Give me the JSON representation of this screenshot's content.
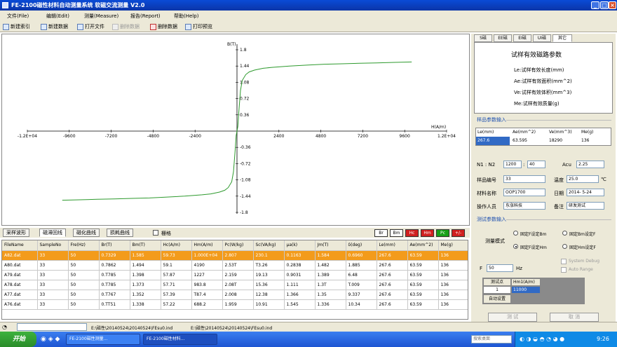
{
  "window": {
    "title": "FE-2100磁性材料自动测量系统 软磁交流测量 V2.0"
  },
  "menu": [
    {
      "label": "文件(File)"
    },
    {
      "label": "编辑(Edit)"
    },
    {
      "label": "测量(Measure)"
    },
    {
      "label": "报告(Report)"
    },
    {
      "label": "帮助(Help)"
    }
  ],
  "toolbar": [
    {
      "label": "新建索引",
      "disabled": false
    },
    {
      "label": "新建数据",
      "disabled": false
    },
    {
      "label": "打开文件",
      "disabled": false
    },
    {
      "label": "删除数据",
      "disabled": true
    },
    {
      "label": "删除数据",
      "disabled": false
    },
    {
      "label": "打印预览",
      "disabled": false
    }
  ],
  "chart_data": {
    "type": "line",
    "title": "",
    "xlabel": "H(A/m)",
    "ylabel": "B(T)",
    "xlim": [
      -12000,
      12000
    ],
    "ylim": [
      -1.8,
      1.8
    ],
    "x_ticks": [
      "-1.2E+04",
      "-9600",
      "-7200",
      "-4800",
      "-2400",
      "2400",
      "4800",
      "7200",
      "9600",
      "1.2E+04"
    ],
    "y_ticks": [
      "1.8",
      "1.44",
      "1.08",
      "0.72",
      "0.36",
      "-0.36",
      "-0.72",
      "-1.08",
      "-1.44",
      "-1.8"
    ],
    "grid": false,
    "series": [
      {
        "color": "#2e9a2e",
        "x": [
          -10000,
          -9000,
          -8000,
          -7000,
          -6000,
          -5000,
          -4000,
          -3000,
          -2000,
          -1500,
          -1000,
          -700,
          -500,
          -300,
          -200,
          -100,
          -50,
          0,
          50,
          100,
          200,
          300,
          500,
          700,
          1000,
          1500,
          2000,
          3000,
          4000,
          5000,
          6000,
          7000,
          8000,
          9000,
          10000
        ],
        "y": [
          -1.53,
          -1.52,
          -1.51,
          -1.5,
          -1.49,
          -1.48,
          -1.46,
          -1.44,
          -1.41,
          -1.39,
          -1.35,
          -1.31,
          -1.25,
          -1.12,
          -0.9,
          -0.4,
          -0.1,
          0.0,
          0.1,
          0.4,
          0.9,
          1.12,
          1.25,
          1.31,
          1.35,
          1.39,
          1.41,
          1.44,
          1.46,
          1.48,
          1.49,
          1.5,
          1.51,
          1.52,
          1.53
        ]
      }
    ]
  },
  "bottom_tabs": [
    {
      "label": "采样波形",
      "active": false
    },
    {
      "label": "磁滞回线",
      "active": true
    },
    {
      "label": "磁化曲线",
      "active": false
    },
    {
      "label": "损耗曲线",
      "active": false
    }
  ],
  "grid_check_label": "栅格",
  "indicators": [
    {
      "label": "Br",
      "color": "#ffffff",
      "text_color": "#000000"
    },
    {
      "label": "Bm",
      "color": "#ffffff",
      "text_color": "#000000"
    },
    {
      "label": "Hc",
      "color": "#d02020",
      "text_color": "#ffffff"
    },
    {
      "label": "Hm",
      "color": "#d02020",
      "text_color": "#ffffff"
    },
    {
      "label": "Pc",
      "color": "#18a018",
      "text_color": "#ffffff"
    },
    {
      "label": "+/-",
      "color": "#d02020",
      "text_color": "#ffffff"
    }
  ],
  "table": {
    "columns": [
      "FileName",
      "SampleNo",
      "Fre(Hz)",
      "Br(T)",
      "Bm(T)",
      "Hc(A/m)",
      "Hm(A/m)",
      "Pc(W/kg)",
      "Sc(VA/kg)",
      "μa(k)",
      "Jm(T)",
      "δ(deg)",
      "Le(mm)",
      "Ae(mm^2)",
      "Me(g)"
    ],
    "rows": [
      [
        "A82.dat",
        "33",
        "50",
        "0.7329",
        "1.585",
        "59.73",
        "1.000E+04",
        "2.807",
        "230.1",
        "0.1163",
        "1.584",
        "0.6960",
        "267.6",
        "63.59",
        "136"
      ],
      [
        "A80.dat",
        "33",
        "50",
        "0.7862",
        "1.494",
        "59.1",
        "4190",
        "2.53T",
        "T3.26",
        "0.2838",
        "1.482",
        "1.885",
        "267.6",
        "63.59",
        "136"
      ],
      [
        "A79.dat",
        "33",
        "50",
        "0.T785",
        "1.398",
        "57.87",
        "1227",
        "2.159",
        "19.13",
        "0.9031",
        "1.389",
        "6.48",
        "267.6",
        "63.59",
        "136"
      ],
      [
        "A78.dat",
        "33",
        "50",
        "0.T785",
        "1.373",
        "57.71",
        "983.8",
        "2.08T",
        "15.36",
        "1.111",
        "1.3T",
        "T.009",
        "267.6",
        "63.59",
        "136"
      ],
      [
        "A77.dat",
        "33",
        "50",
        "0.T767",
        "1.352",
        "57.39",
        "T87.4",
        "2.008",
        "12.38",
        "1.366",
        "1.35",
        "9.337",
        "267.6",
        "63.59",
        "136"
      ],
      [
        "A76.dat",
        "33",
        "50",
        "0.TT51",
        "1.338",
        "57.22",
        "688.2",
        "1.959",
        "10.91",
        "1.545",
        "1.336",
        "10.34",
        "267.6",
        "63.59",
        "136"
      ]
    ]
  },
  "right": {
    "tabs": [
      {
        "label": "S磁",
        "active": false
      },
      {
        "label": "EE磁",
        "active": false
      },
      {
        "label": "EI磁",
        "active": false
      },
      {
        "label": "UI磁",
        "active": false
      },
      {
        "label": "其它",
        "active": true
      }
    ],
    "info_title": "试样有效磁路参数",
    "info_lines": [
      "Le:试样有效长度(mm)",
      "Ae:试样有效面积(mm^2)",
      "Ve:试样有效体积(mm^3)",
      "Me:试样有效质量(g)"
    ],
    "sample_group_title": "样品参数输入",
    "sample_headers": [
      "Le(mm)",
      "Ae(mm^2)",
      "Ve(mm^3)",
      "Me(g)"
    ],
    "sample_values": [
      "267.6",
      "63.595",
      "18290",
      "136"
    ],
    "n_label": "N1 : N2",
    "n1": "1200",
    "n2": "40",
    "acu_label": "Acu",
    "acu": "2.25",
    "sample_no_label": "样品编号",
    "sample_no": "33",
    "temp_label": "温度",
    "temp": "25.0",
    "temp_unit": "℃",
    "material_label": "材料名称",
    "material": "OOP1700",
    "date_label": "日期",
    "date": "2014- 5-24",
    "operator_label": "操作人员",
    "operator": "东涨科技",
    "remark_label": "备注",
    "remark": "研发测试",
    "test_group_title": "测试参数输入",
    "mode_label": "测量模式",
    "modes": [
      {
        "label": "固定F设定Bm",
        "on": false
      },
      {
        "label": "固定Bm设定F",
        "on": false
      },
      {
        "label": "固定F设定Hm",
        "on": true
      },
      {
        "label": "固定Hm设定F",
        "on": false
      }
    ],
    "f_label": "F",
    "f_value": "50",
    "f_unit": "Hz",
    "sys_debug": "System Debug",
    "auto_range": "Auto Range",
    "points_headers": [
      "测试点",
      "Hm1(A/m)"
    ],
    "points_row": [
      "1",
      "11000"
    ],
    "auto_set": "自动设置",
    "test_btn": "测 试",
    "cancel_btn": "取 消"
  },
  "status": {
    "path1": "E:\\磁性\\20140524\\20140524\\FEsu0.ind",
    "path2": "E:\\磁性\\20140524\\20140524\\FEsu0.ind"
  },
  "taskbar": {
    "start": "开始",
    "tasks": [
      "FE-2100磁性测量...",
      "FE-2100磁性材料..."
    ],
    "search_placeholder": "搜索桌面",
    "clock": "9:26"
  }
}
